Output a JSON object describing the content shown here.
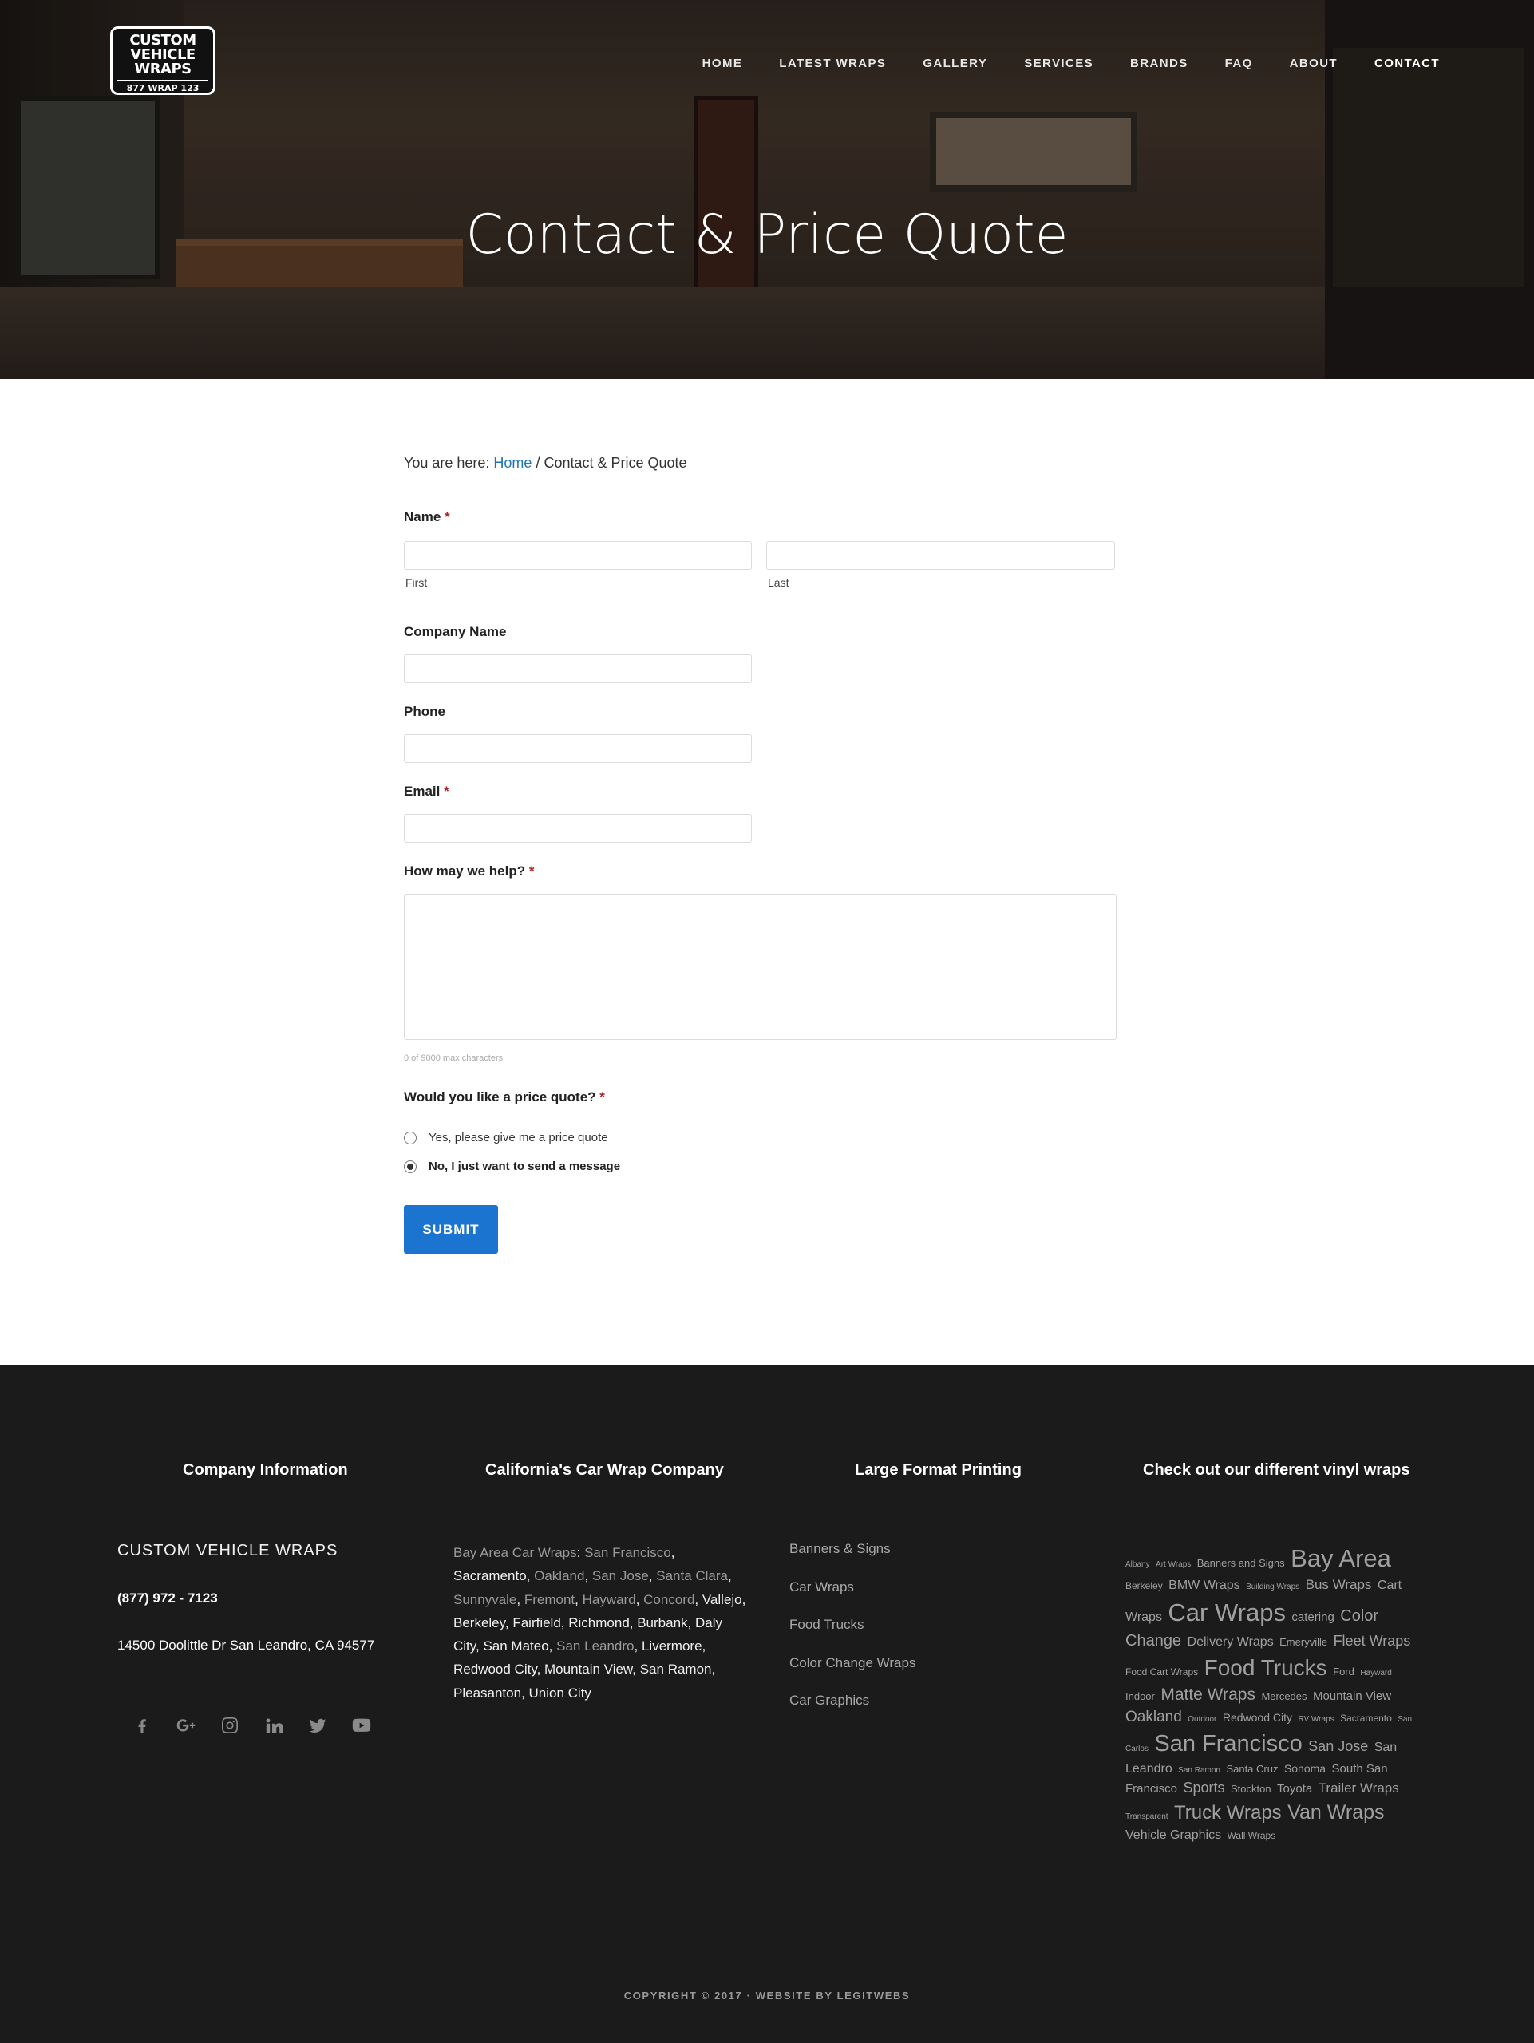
{
  "logo": {
    "line1": "CUSTOM VEHICLE WRAPS",
    "line2": "877 WRAP 123"
  },
  "nav": [
    {
      "label": "HOME"
    },
    {
      "label": "LATEST WRAPS"
    },
    {
      "label": "GALLERY"
    },
    {
      "label": "SERVICES"
    },
    {
      "label": "BRANDS"
    },
    {
      "label": "FAQ"
    },
    {
      "label": "ABOUT"
    },
    {
      "label": "CONTACT"
    }
  ],
  "hero": {
    "title": "Contact & Price Quote"
  },
  "breadcrumb": {
    "prefix": "You are here: ",
    "home": "Home",
    "separator": " / ",
    "current": "Contact & Price Quote"
  },
  "form": {
    "name_label": "Name",
    "required_mark": "*",
    "first_sublabel": "First",
    "last_sublabel": "Last",
    "company_label": "Company Name",
    "phone_label": "Phone",
    "email_label": "Email",
    "help_label": "How may we help?",
    "char_counter": "0 of 9000 max characters",
    "quote_label": "Would you like a price quote?",
    "option_yes": "Yes, please give me a price quote",
    "option_no": "No, I just want to send a message",
    "selected_option": "no",
    "submit_label": "SUBMIT"
  },
  "footer": {
    "col1_title": "Company Information",
    "col2_title": "California's Car Wrap Company",
    "col3_title": "Large Format Printing",
    "col4_title": "Check out our different vinyl wraps",
    "brand_name": "CUSTOM VEHICLE WRAPS",
    "phone": "(877) 972 - 7123",
    "address": "14500 Doolittle Dr San Leandro, CA 94577",
    "social_icons": [
      "facebook-icon",
      "google-plus-icon",
      "instagram-icon",
      "linkedin-icon",
      "twitter-icon",
      "youtube-icon"
    ],
    "cities": [
      {
        "text": "Bay Area Car Wraps",
        "link": true
      },
      {
        "text": ": ",
        "link": false
      },
      {
        "text": "San Francisco",
        "link": true
      },
      {
        "text": ", Sacramento, ",
        "link": false
      },
      {
        "text": "Oakland",
        "link": true
      },
      {
        "text": ", ",
        "link": false
      },
      {
        "text": "San Jose",
        "link": true
      },
      {
        "text": ", ",
        "link": false
      },
      {
        "text": "Santa Clara",
        "link": true
      },
      {
        "text": ", ",
        "link": false
      },
      {
        "text": "Sunnyvale",
        "link": true
      },
      {
        "text": ", ",
        "link": false
      },
      {
        "text": "Fremont",
        "link": true
      },
      {
        "text": ", ",
        "link": false
      },
      {
        "text": "Hayward",
        "link": true
      },
      {
        "text": ", ",
        "link": false
      },
      {
        "text": "Concord",
        "link": true
      },
      {
        "text": ", Vallejo, Berkeley, Fairfield, Richmond, Burbank, Daly City, San Mateo, ",
        "link": false
      },
      {
        "text": "San Leandro",
        "link": true
      },
      {
        "text": ", Livermore, Redwood City, Mountain View, San Ramon, Pleasanton, Union City",
        "link": false
      }
    ],
    "printing_links": [
      "Banners & Signs",
      "Car Wraps",
      "Food Trucks",
      "Color Change Wraps",
      "Car Graphics"
    ],
    "tag_cloud": [
      {
        "t": "Albany",
        "s": 10
      },
      {
        "t": "Art Wraps",
        "s": 10
      },
      {
        "t": "Banners and Signs",
        "s": 13
      },
      {
        "t": "Bay Area",
        "s": 31
      },
      {
        "t": "Berkeley",
        "s": 12
      },
      {
        "t": "BMW Wraps",
        "s": 16
      },
      {
        "t": "Building Wraps",
        "s": 10
      },
      {
        "t": "Bus Wraps",
        "s": 17
      },
      {
        "t": "Cart Wraps",
        "s": 16
      },
      {
        "t": "Car Wraps",
        "s": 31
      },
      {
        "t": "catering",
        "s": 15
      },
      {
        "t": "Color Change",
        "s": 20
      },
      {
        "t": "Delivery Wraps",
        "s": 16
      },
      {
        "t": "Emeryville",
        "s": 13
      },
      {
        "t": "Fleet Wraps",
        "s": 18
      },
      {
        "t": "Food Cart Wraps",
        "s": 12
      },
      {
        "t": "Food Trucks",
        "s": 28
      },
      {
        "t": "Ford",
        "s": 13
      },
      {
        "t": "Hayward",
        "s": 10
      },
      {
        "t": "Indoor",
        "s": 13
      },
      {
        "t": "Matte Wraps",
        "s": 21
      },
      {
        "t": "Mercedes",
        "s": 13
      },
      {
        "t": "Mountain View",
        "s": 15
      },
      {
        "t": "Oakland",
        "s": 19
      },
      {
        "t": "Outdoor",
        "s": 10
      },
      {
        "t": "Redwood City",
        "s": 14
      },
      {
        "t": "RV Wraps",
        "s": 10
      },
      {
        "t": "Sacramento",
        "s": 12
      },
      {
        "t": "San Carlos",
        "s": 10
      },
      {
        "t": "San Francisco",
        "s": 29
      },
      {
        "t": "San Jose",
        "s": 18
      },
      {
        "t": "San Leandro",
        "s": 16
      },
      {
        "t": "San Ramon",
        "s": 10
      },
      {
        "t": "Santa Cruz",
        "s": 13
      },
      {
        "t": "Sonoma",
        "s": 14
      },
      {
        "t": "South San Francisco",
        "s": 15
      },
      {
        "t": "Sports",
        "s": 18
      },
      {
        "t": "Stockton",
        "s": 13
      },
      {
        "t": "Toyota",
        "s": 15
      },
      {
        "t": "Trailer Wraps",
        "s": 17
      },
      {
        "t": "Transparent",
        "s": 10
      },
      {
        "t": "Truck Wraps",
        "s": 24
      },
      {
        "t": "Van Wraps",
        "s": 25
      },
      {
        "t": "Vehicle Graphics",
        "s": 16
      },
      {
        "t": "Wall Wraps",
        "s": 12
      }
    ],
    "copyright": "COPYRIGHT © 2017 · WEBSITE BY LEGITWEBS"
  }
}
